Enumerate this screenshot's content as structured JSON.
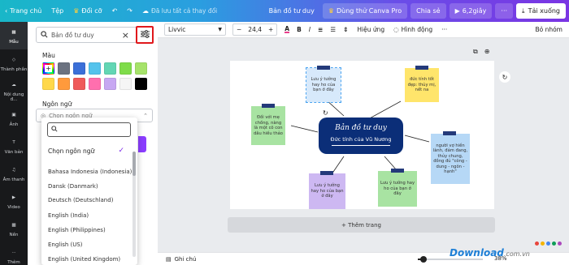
{
  "topbar": {
    "home": "Trang chủ",
    "file": "Tệp",
    "resize": "Đổi cỡ",
    "saved": "Đã lưu tất cả thay đổi",
    "doc_title": "Bản đồ tư duy",
    "try_pro": "Dùng thử Canva Pro",
    "share": "Chia sẻ",
    "duration": "6,2giây",
    "download": "Tải xuống"
  },
  "rail": [
    {
      "label": "Mẫu",
      "icon": "template-icon"
    },
    {
      "label": "Thành phần",
      "icon": "elements-icon"
    },
    {
      "label": "Nội dung đ...",
      "icon": "upload-icon"
    },
    {
      "label": "Ảnh",
      "icon": "photo-icon"
    },
    {
      "label": "Văn bản",
      "icon": "text-icon"
    },
    {
      "label": "Âm thanh",
      "icon": "audio-icon"
    },
    {
      "label": "Video",
      "icon": "video-icon"
    },
    {
      "label": "Nền",
      "icon": "background-icon"
    },
    {
      "label": "Thêm",
      "icon": "more-icon"
    }
  ],
  "panel": {
    "search_value": "Bản đồ tư duy",
    "color_title": "Màu",
    "colors": [
      "#ffffff",
      "#6b7280",
      "#3b6fd8",
      "#54c3ec",
      "#63d6b4",
      "#7fdc4a",
      "#a6e36a",
      "#ffd84a",
      "#ff9a3c",
      "#ef5a5a",
      "#ff6fae",
      "#c7a7f2",
      "#f5f5f5",
      "#000000"
    ],
    "lang_title": "Ngôn ngữ",
    "lang_placeholder": "Chọn ngôn ngữ",
    "dropdown": {
      "first": "Chọn ngôn ngữ",
      "items": [
        "Bahasa Indonesia (Indonesia)",
        "Dansk (Danmark)",
        "Deutsch (Deutschland)",
        "English (India)",
        "English (Philippines)",
        "English (US)",
        "English (United Kingdom)"
      ]
    }
  },
  "toolbar": {
    "font": "Livvic",
    "size": "24,4",
    "effects": "Hiệu ứng",
    "animate": "Hình động",
    "ungroup": "Bỏ nhóm"
  },
  "mindmap": {
    "center_title": "Bản đồ tư duy",
    "center_sub": "Đức tính của Vũ Nương",
    "notes": [
      "Lưu ý tưởng hay ho của bạn ở đây",
      "đức tính tốt đẹp: thủy mị, nết na",
      "Đối với mẹ chồng, nàng là một cô con dâu hiếu thảo",
      "người vợ hiền lành, đảm đang, thủy chung, đồng đủ \"công - dung - ngôn - hạnh\"",
      "Lưu ý tưởng hay ho của bạn ở đây",
      "Lưu ý tưởng hay ho của bạn ở đây"
    ]
  },
  "add_page": "+ Thêm trang",
  "bottombar": {
    "notes": "Ghi chú",
    "zoom": "38%"
  },
  "watermark": {
    "brand": "Download",
    "domain": ".com.vn"
  }
}
